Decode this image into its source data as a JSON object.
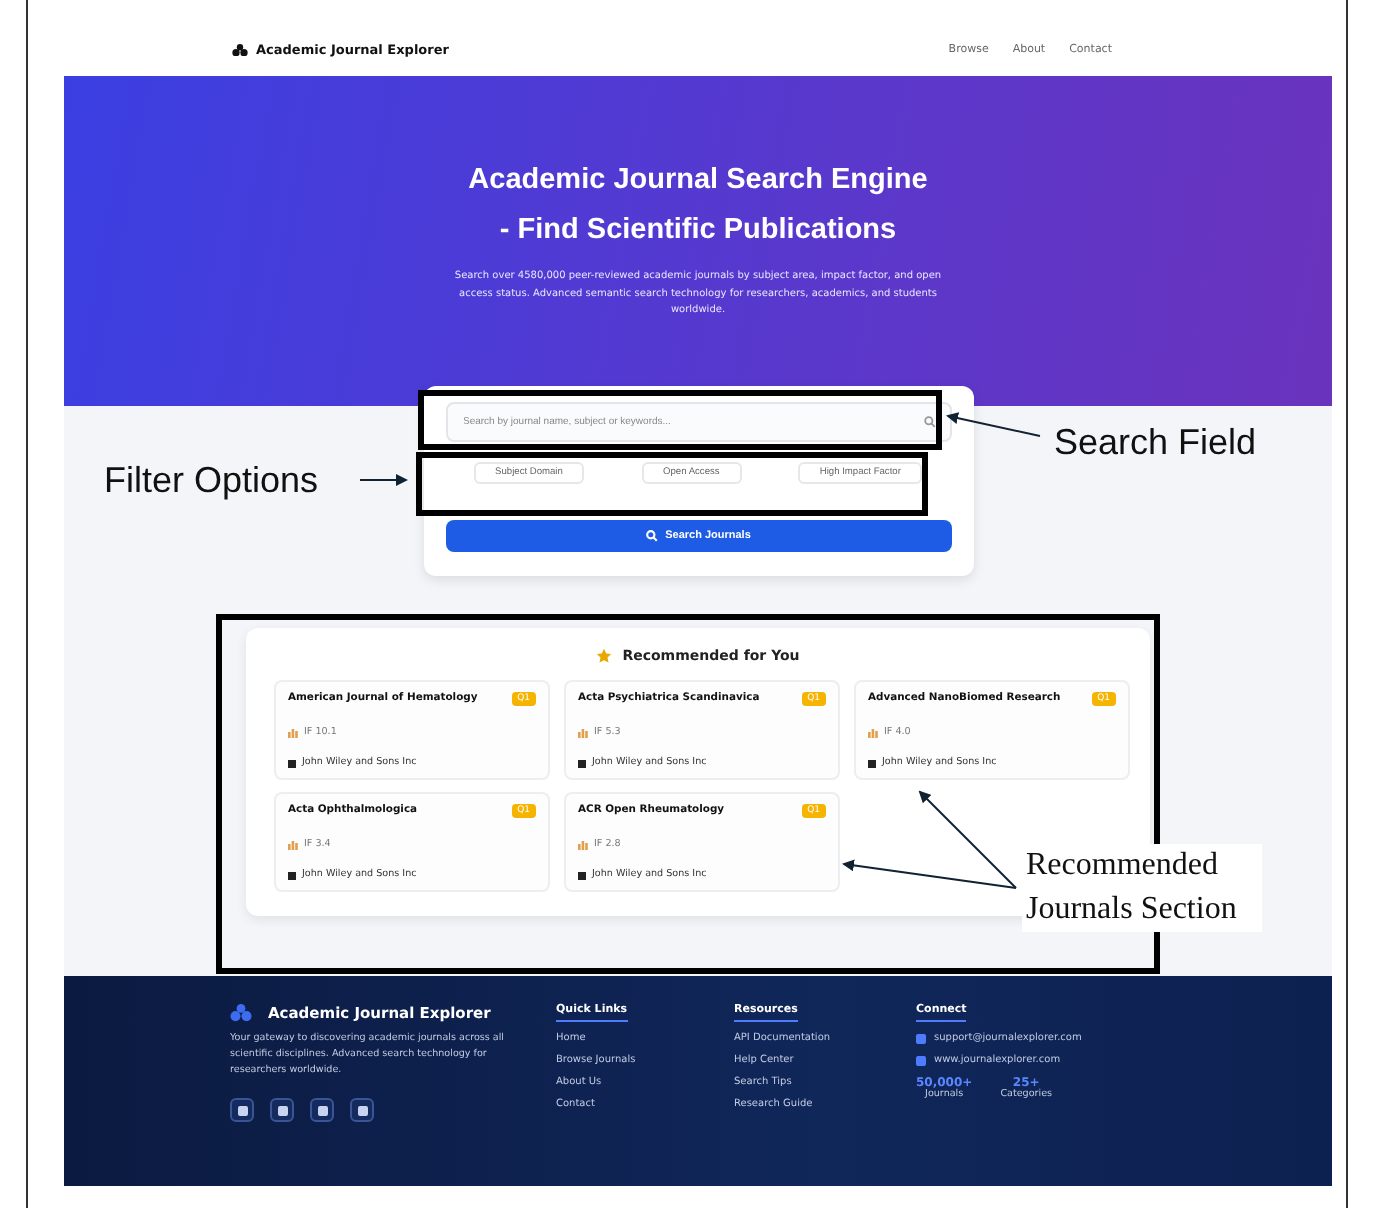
{
  "nav": {
    "brand": "Academic Journal Explorer",
    "links": [
      "Browse",
      "About",
      "Contact"
    ]
  },
  "hero": {
    "title_lines": [
      "Academic Journal Search Engine",
      "- Find Scientific Publications"
    ],
    "subtitle": "Search over 4580,000 peer-reviewed academic journals by subject area, impact factor, and open access status. Advanced semantic search technology for researchers, academics, and students worldwide."
  },
  "search": {
    "placeholder": "Search by journal name, subject or keywords...",
    "filters": [
      "Subject Domain",
      "Open Access",
      "High Impact Factor"
    ],
    "button": "Search Journals"
  },
  "recommended": {
    "title": "Recommended for You",
    "journals": [
      {
        "name": "American Journal of Hematology",
        "badge": "Q1",
        "impact": "IF 10.1",
        "publisher": "John Wiley and Sons Inc"
      },
      {
        "name": "Acta Psychiatrica Scandinavica",
        "badge": "Q1",
        "impact": "IF 5.3",
        "publisher": "John Wiley and Sons Inc"
      },
      {
        "name": "Advanced NanoBiomed Research",
        "badge": "Q1",
        "impact": "IF 4.0",
        "publisher": "John Wiley and Sons Inc"
      },
      {
        "name": "Acta Ophthalmologica",
        "badge": "Q1",
        "impact": "IF 3.4",
        "publisher": "John Wiley and Sons Inc"
      },
      {
        "name": "ACR Open Rheumatology",
        "badge": "Q1",
        "impact": "IF 2.8",
        "publisher": "John Wiley and Sons Inc"
      }
    ]
  },
  "footer": {
    "brand": "Academic Journal Explorer",
    "about": "Your gateway to discovering academic journals across all scientific disciplines. Advanced search technology for researchers worldwide.",
    "columns": [
      {
        "title": "Quick Links",
        "items": [
          "Home",
          "Browse Journals",
          "About Us",
          "Contact"
        ]
      },
      {
        "title": "Resources",
        "items": [
          "API Documentation",
          "Help Center",
          "Search Tips",
          "Research Guide"
        ]
      }
    ],
    "contact": {
      "title": "Connect",
      "items": [
        "support@journalexplorer.com",
        "www.journalexplorer.com"
      ],
      "stats": [
        {
          "value": "50,000+",
          "label": "Journals"
        },
        {
          "value": "25+",
          "label": "Categories"
        }
      ]
    }
  },
  "annotations": [
    {
      "label": "Search Field"
    },
    {
      "label": "Filter Options"
    },
    {
      "label": "Recommended Journals Section"
    }
  ]
}
